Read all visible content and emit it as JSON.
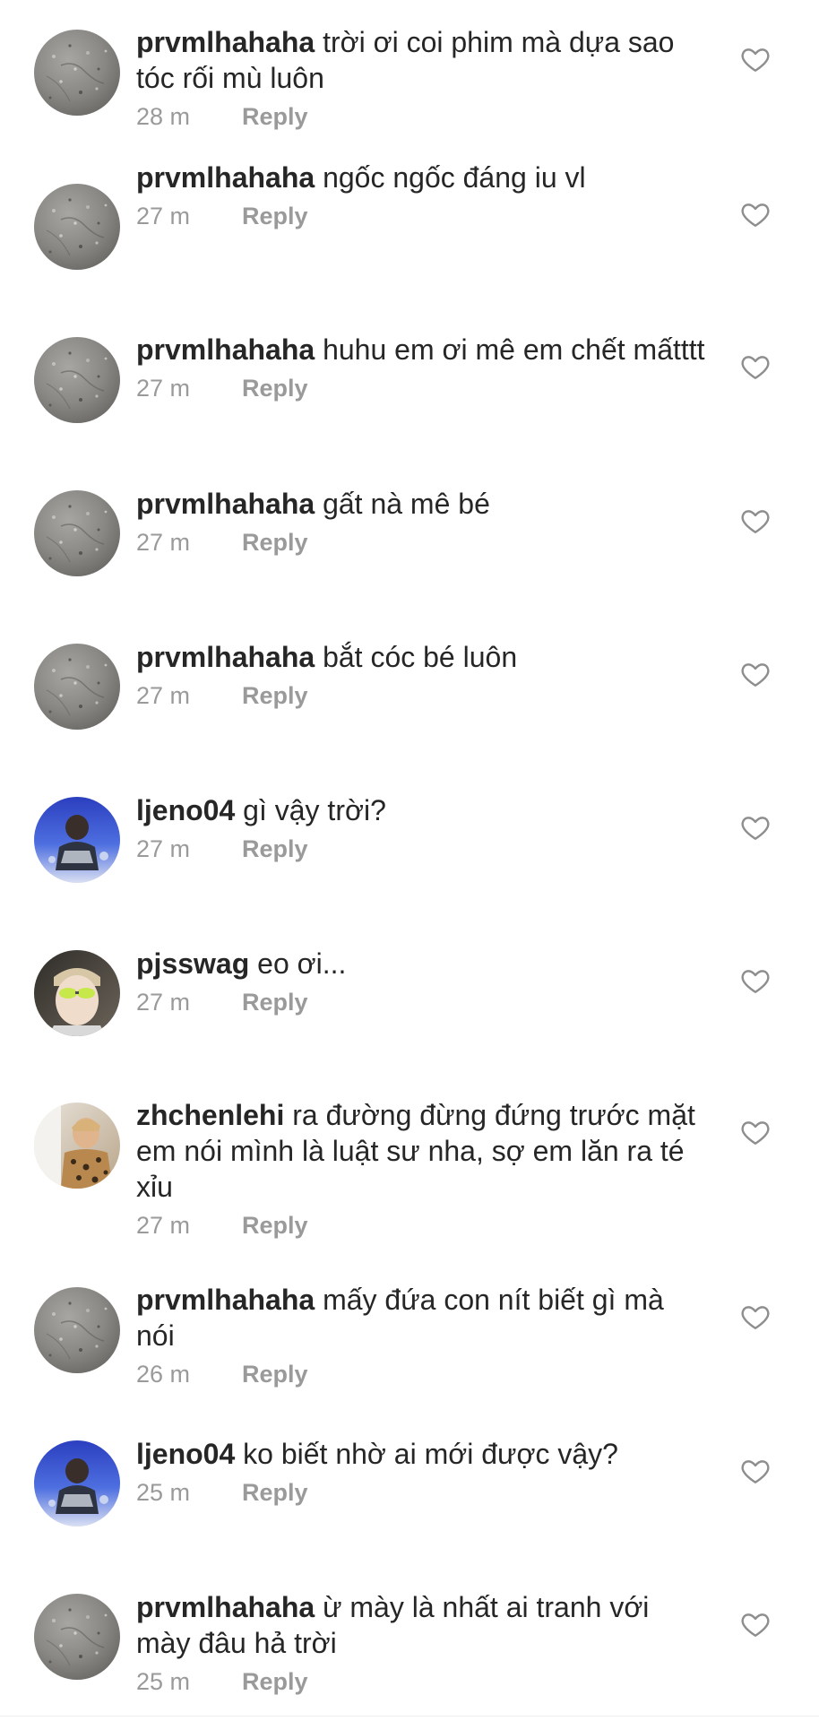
{
  "comments": [
    {
      "username": "prvmlhahaha",
      "text": "trời ơi coi phim mà dựa sao tóc rối mù luôn",
      "time": "28 m",
      "reply": "Reply",
      "avatar": "gray-stone"
    },
    {
      "username": "prvmlhahaha",
      "text": "ngốc ngốc đáng iu vl",
      "time": "27 m",
      "reply": "Reply",
      "avatar": "gray-stone"
    },
    {
      "username": "prvmlhahaha",
      "text": "huhu em ơi mê em chết mấtttt",
      "time": "27 m",
      "reply": "Reply",
      "avatar": "gray-stone"
    },
    {
      "username": "prvmlhahaha",
      "text": "gất nà mê bé",
      "time": "27 m",
      "reply": "Reply",
      "avatar": "gray-stone"
    },
    {
      "username": "prvmlhahaha",
      "text": "bắt cóc bé luôn",
      "time": "27 m",
      "reply": "Reply",
      "avatar": "gray-stone"
    },
    {
      "username": "ljeno04",
      "text": "gì vậy trời?",
      "time": "27 m",
      "reply": "Reply",
      "avatar": "blue-photo"
    },
    {
      "username": "pjsswag",
      "text": "eo ơi...",
      "time": "27 m",
      "reply": "Reply",
      "avatar": "sunglasses-photo"
    },
    {
      "username": "zhchenlehi",
      "text": "ra đường đừng đứng trước mặt em nói mình là luật sư nha, sợ em lăn ra té xỉu",
      "time": "27 m",
      "reply": "Reply",
      "avatar": "leopard-photo"
    },
    {
      "username": "prvmlhahaha",
      "text": "mấy đứa con nít biết gì mà nói",
      "time": "26 m",
      "reply": "Reply",
      "avatar": "gray-stone"
    },
    {
      "username": "ljeno04",
      "text": "ko biết nhờ ai mới được vậy?",
      "time": "25 m",
      "reply": "Reply",
      "avatar": "blue-photo"
    },
    {
      "username": "prvmlhahaha",
      "text": "ừ mày là nhất ai tranh với mày đâu hả trời",
      "time": "25 m",
      "reply": "Reply",
      "avatar": "gray-stone"
    }
  ],
  "icons": {
    "like": "heart-outline-icon"
  },
  "colors": {
    "text": "#262626",
    "meta": "#9a9a9a",
    "heart": "#8e8e8e",
    "background": "#ffffff"
  }
}
